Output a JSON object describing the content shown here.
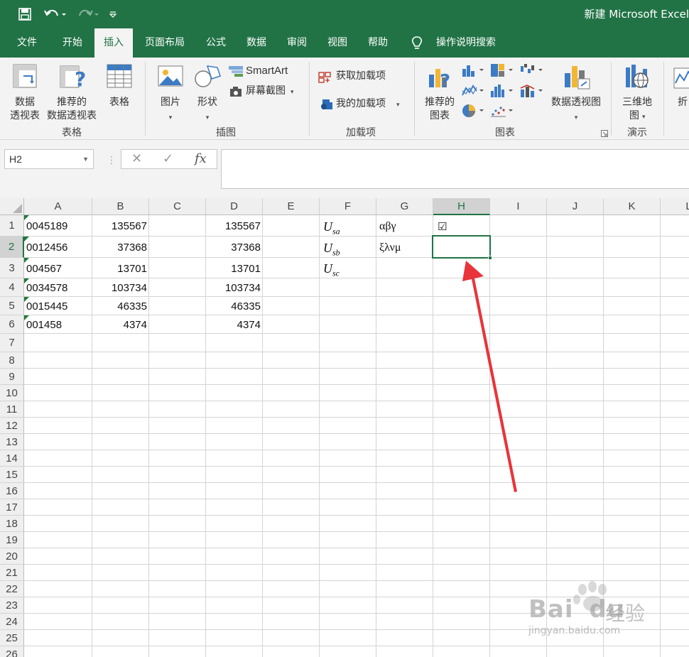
{
  "titlebar": {
    "title": "新建 Microsoft Excel",
    "save_icon": "save-icon",
    "undo_icon": "undo-icon",
    "redo_icon": "redo-icon",
    "customize_icon": "customize-qat-icon"
  },
  "tabs": [
    "文件",
    "开始",
    "插入",
    "页面布局",
    "公式",
    "数据",
    "审阅",
    "视图",
    "帮助",
    "操作说明搜索"
  ],
  "active_tab": "插入",
  "ribbon": {
    "pivot_table": "数据\n透视表",
    "pivot_table_l1": "数据",
    "pivot_table_l2": "透视表",
    "recommended_pivot_l1": "推荐的",
    "recommended_pivot_l2": "数据透视表",
    "table": "表格",
    "group_tables": "表格",
    "pictures": "图片",
    "shapes": "形状",
    "smartart": "SmartArt",
    "screenshot": "屏幕截图",
    "group_illustrations": "插图",
    "get_addins": "获取加载项",
    "my_addins": "我的加载项",
    "group_addins": "加载项",
    "recommended_charts_l1": "推荐的",
    "recommended_charts_l2": "图表",
    "pivot_chart": "数据透视图",
    "group_charts": "图表",
    "map3d_l1": "三维地",
    "map3d_l2": "图",
    "group_tours": "演示",
    "sparkline_partial": "折"
  },
  "formula_bar": {
    "name_box": "H2",
    "cancel": "✕",
    "enter": "✓",
    "fx": "fx",
    "content": ""
  },
  "sheet": {
    "columns": [
      "A",
      "B",
      "C",
      "D",
      "E",
      "F",
      "G",
      "H",
      "I",
      "J",
      "K",
      "L"
    ],
    "rows": [
      "1",
      "2",
      "3",
      "4",
      "5",
      "6",
      "7",
      "8",
      "9",
      "10",
      "11",
      "12",
      "13",
      "14",
      "15",
      "16",
      "17",
      "18",
      "19",
      "20",
      "21",
      "22",
      "23",
      "24",
      "25",
      "26"
    ],
    "selected_cell": "H2",
    "colA": [
      "0045189",
      "0012456",
      "004567",
      "0034578",
      "0015445",
      "001458"
    ],
    "colB": [
      "135567",
      "37368",
      "13701",
      "103734",
      "46335",
      "4374"
    ],
    "colD": [
      "135567",
      "37368",
      "13701",
      "103734",
      "46335",
      "4374"
    ],
    "colF": [
      {
        "base": "U",
        "sub": "sa"
      },
      {
        "base": "U",
        "sub": "sb"
      },
      {
        "base": "U",
        "sub": "sc"
      }
    ],
    "colG": [
      "αβγ",
      "ξλνμ"
    ],
    "H1": "☑"
  },
  "watermark": {
    "brand": "Bai",
    "brand2": "du",
    "cn": "经验",
    "url": "jingyan.baidu.com"
  },
  "colors": {
    "excel_green": "#217346",
    "arrow_red": "#e8343a"
  }
}
